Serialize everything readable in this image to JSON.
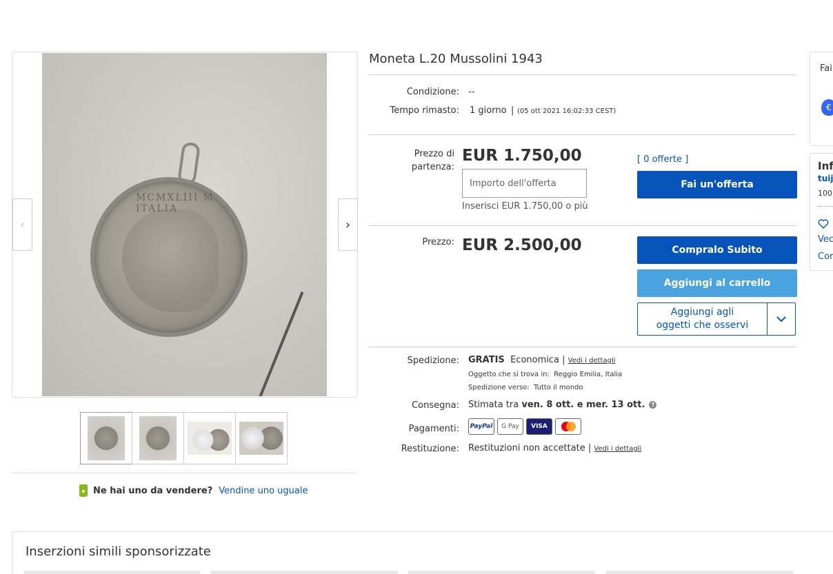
{
  "gallery": {
    "coin_inscription": "MCMXLIII  M. ITALIA",
    "prev_label": "‹",
    "next_label": "›",
    "thumbnails": [
      "thumb-1",
      "thumb-2",
      "thumb-3",
      "thumb-4"
    ]
  },
  "sell": {
    "question": "Ne hai uno da vendere?",
    "link": "Vendine uno uguale"
  },
  "item": {
    "title": "Moneta L.20 Mussolini 1943",
    "condition_label": "Condizione:",
    "condition_value": "--",
    "time_label": "Tempo rimasto:",
    "time_value": "1 giorno",
    "time_sep": "|",
    "time_end": "(05 ott 2021  16:02:33 CEST)"
  },
  "auction": {
    "start_label_1": "Prezzo di",
    "start_label_2": "partenza:",
    "start_price": "EUR 1.750,00",
    "bid_placeholder": "Importo dell'offerta",
    "bid_hint": "Inserisci EUR 1.750,00 o più",
    "offers_link": "[ 0 offerte ]",
    "offer_button": "Fai un'offerta"
  },
  "buy": {
    "price_label": "Prezzo:",
    "price": "EUR 2.500,00",
    "buy_button": "Compralo Subito",
    "cart_button": "Aggiungi al carrello",
    "watch_line1": "Aggiungi agli",
    "watch_line2": "oggetti che osservi"
  },
  "shipping": {
    "label": "Spedizione:",
    "free": "GRATIS",
    "type": "Economica",
    "sep": "|",
    "details_link": "Vedi i dettagli",
    "location_label": "Oggetto che si trova in:",
    "location": "Reggio Emilia, Italia",
    "ship_to_label": "Spedizione verso:",
    "ship_to": "Tutto il mondo"
  },
  "delivery": {
    "label": "Consegna:",
    "prefix": "Stimata tra",
    "range": "ven. 8 ott. e mer. 13 ott."
  },
  "payments": {
    "label": "Pagamenti:",
    "methods": [
      "PayPal",
      "G Pay",
      "VISA",
      "Mastercard"
    ]
  },
  "returns": {
    "label": "Restituzione:",
    "value": "Restituzioni non accettate",
    "sep": "|",
    "details_link": "Vedi i dettagli"
  },
  "side": {
    "panel1_text": "Fai",
    "panel2_title": "Inf",
    "panel2_seller": "tuij",
    "panel2_feedback": "100'",
    "panel2_link1": "Vec",
    "panel2_link2": "Cor"
  },
  "sponsored": {
    "title": "Inserzioni simili sponsorizzate"
  },
  "colors": {
    "primary": "#0654ba",
    "cart": "#4aa3df",
    "tag": "#86b817"
  }
}
